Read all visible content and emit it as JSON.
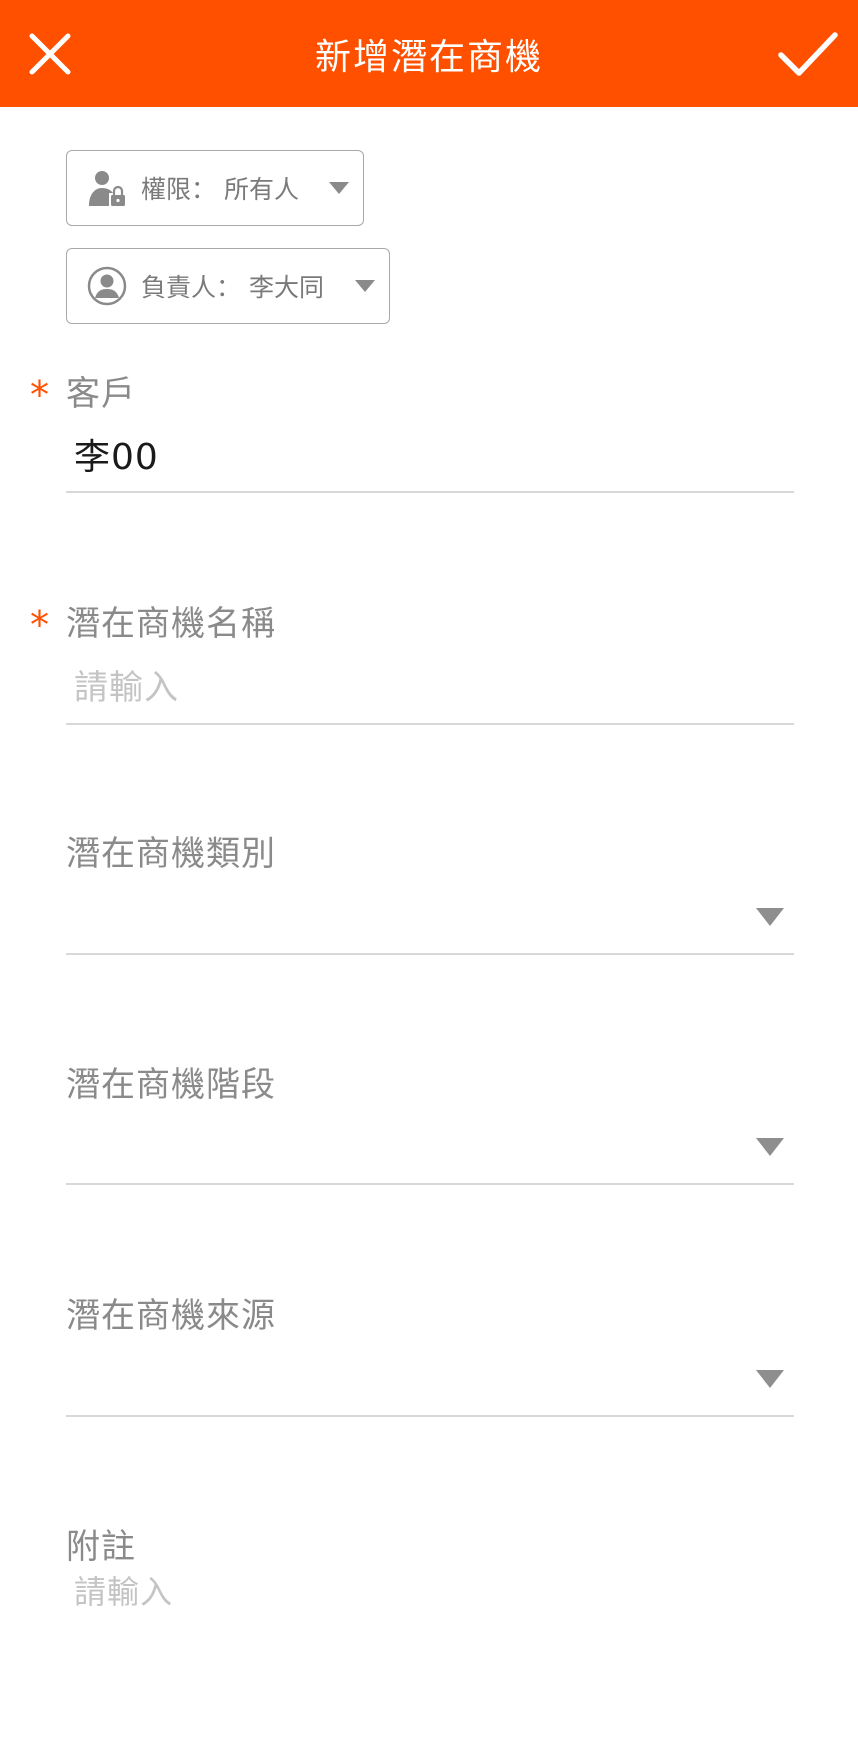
{
  "header": {
    "title": "新增潛在商機",
    "close_icon": "close-icon",
    "confirm_icon": "check-icon",
    "bg_color": "#ff5000"
  },
  "chips": {
    "permission": {
      "label": "權限：  所有人",
      "icon": "user-lock-icon"
    },
    "owner": {
      "label": "負責人：  李大同",
      "icon": "user-circle-icon"
    }
  },
  "fields": {
    "customer": {
      "label": "客戶",
      "required": true,
      "value": "李00"
    },
    "name": {
      "label": "潛在商機名稱",
      "required": true,
      "placeholder": "請輸入"
    },
    "category": {
      "label": "潛在商機類別",
      "value": ""
    },
    "stage": {
      "label": "潛在商機階段",
      "value": ""
    },
    "source": {
      "label": "潛在商機來源",
      "value": ""
    },
    "note": {
      "label": "附註",
      "placeholder": "請輸入"
    }
  },
  "required_mark": "*",
  "accent_color": "#ff5000"
}
